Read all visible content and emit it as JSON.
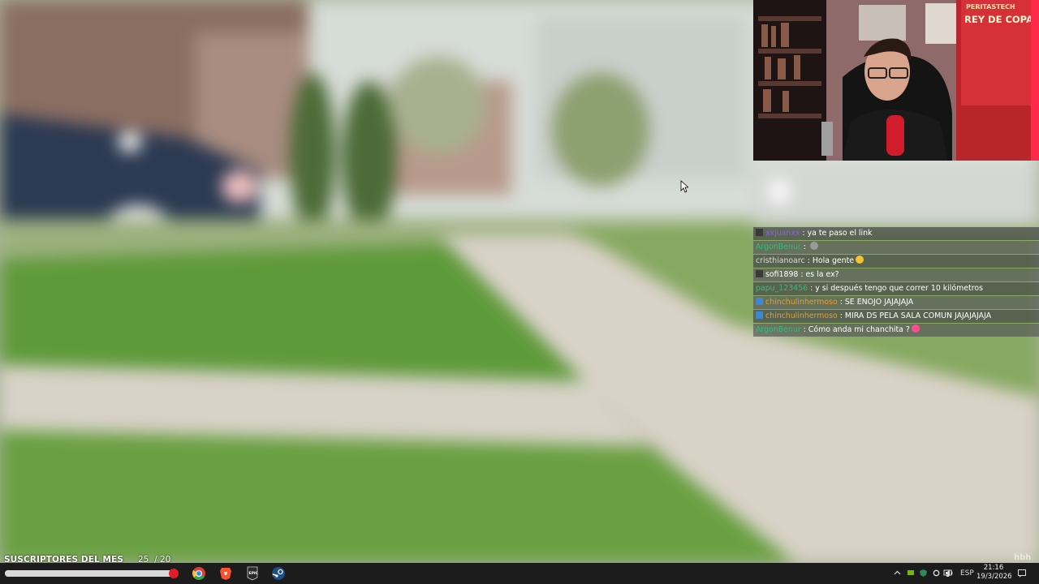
{
  "overlay": {
    "subs_label": "SUSCRIPTORES DEL MES",
    "subs_count": "25",
    "subs_goal": "/ 20",
    "subs_progress": 1.0,
    "watermark": "hbh"
  },
  "chat": [
    {
      "user": "xxjuanxx",
      "user_color": "#8a5cf6",
      "badge": "mod",
      "text": "ya te paso el link",
      "emote": ""
    },
    {
      "user": "ArgonBenur",
      "user_color": "#2fbf71",
      "badge": "",
      "text": "",
      "emote": "emote-gray"
    },
    {
      "user": "cristhianoarc",
      "user_color": "#d9d9d9",
      "badge": "",
      "text": "Hola gente",
      "emote": "emote-yellow"
    },
    {
      "user": "sofi1898",
      "user_color": "#ffffff",
      "badge": "mod",
      "text": "es la ex?",
      "emote": ""
    },
    {
      "user": "papu_123456",
      "user_color": "#2fbf71",
      "badge": "",
      "text": "y si después tengo que correr 10 kilómetros",
      "emote": ""
    },
    {
      "user": "chinchulinhermoso",
      "user_color": "#e0a030",
      "badge": "sub",
      "text": "SE ENOJO JAJAJAJA",
      "emote": ""
    },
    {
      "user": "chinchulinhermoso",
      "user_color": "#e0a030",
      "badge": "sub",
      "text": "MIRA DS PELA SALA COMUN JAJAJAJAJA",
      "emote": ""
    },
    {
      "user": "ArgonBenur",
      "user_color": "#2fbf71",
      "badge": "",
      "text": "Cómo anda mi chanchita ?",
      "emote": "emote-pink"
    }
  ],
  "webcam": {
    "banner_top": "PERITASTECH",
    "banner_main": "REY DE COPAS"
  },
  "taskbar": {
    "apps": [
      "chrome-icon",
      "brave-icon",
      "epic-games-icon",
      "steam-icon"
    ],
    "tray": {
      "lang": "ESP",
      "time": "21:16",
      "date": "19/3/2026"
    }
  },
  "colors": {
    "taskbar": "#1c1c1c",
    "chat_bg": "#464848",
    "progress_end": "#e31b2b"
  }
}
